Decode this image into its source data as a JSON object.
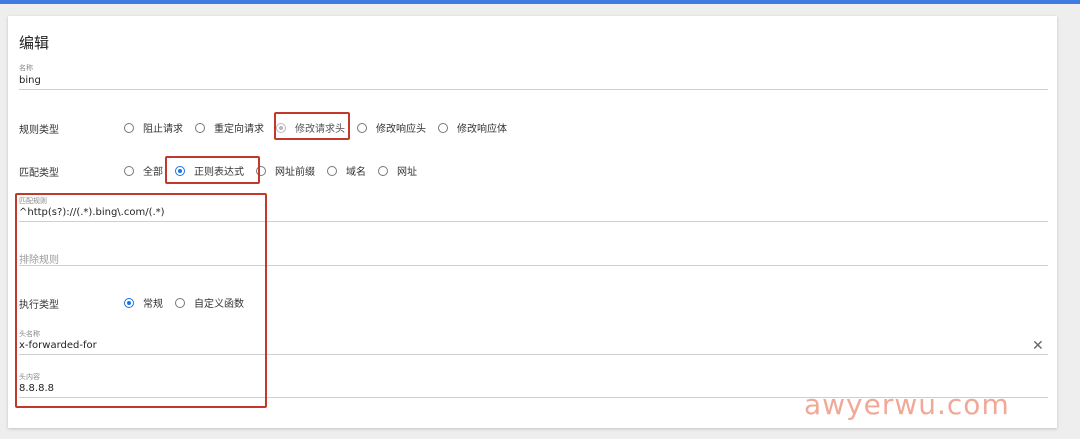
{
  "page": {
    "title": "编辑"
  },
  "name_field": {
    "label": "名称",
    "value": "bing"
  },
  "rule_type": {
    "label": "规则类型",
    "options": [
      "阻止请求",
      "重定向请求",
      "修改请求头",
      "修改响应头",
      "修改响应体"
    ],
    "selected": "修改请求头"
  },
  "match_type": {
    "label": "匹配类型",
    "options": [
      "全部",
      "正则表达式",
      "网址前缀",
      "域名",
      "网址"
    ],
    "selected": "正则表达式"
  },
  "match_rule": {
    "label": "匹配规则",
    "value": "^http(s?)://(.*).bing\\.com/(.*)"
  },
  "exclude_rule": {
    "placeholder": "排除规则"
  },
  "exec_type": {
    "label": "执行类型",
    "options": [
      "常规",
      "自定义函数"
    ],
    "selected": "常规"
  },
  "header_name": {
    "label": "头名称",
    "value": "x-forwarded-for"
  },
  "header_value": {
    "label": "头内容",
    "value": "8.8.8.8"
  },
  "icons": {
    "clear": "close-icon"
  },
  "colors": {
    "accent": "#1a73e8",
    "highlight_box": "#c0392b",
    "top_bar": "#3f7be0"
  },
  "watermark": "awyerwu.com"
}
